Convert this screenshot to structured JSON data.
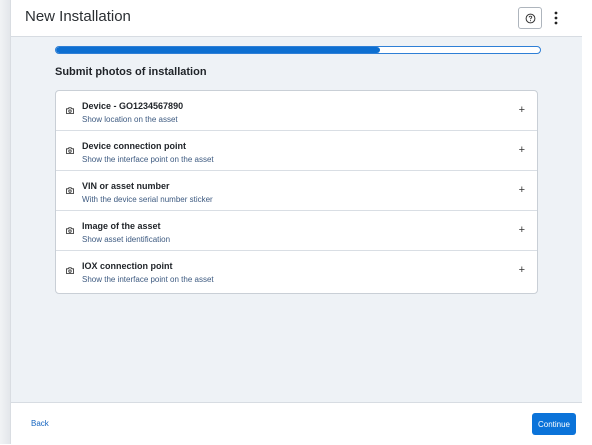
{
  "header": {
    "title": "New Installation",
    "help_icon": "question-circle-icon",
    "more_icon": "more-vertical-icon"
  },
  "progress": {
    "fraction": 0.67
  },
  "section": {
    "title": "Submit photos of installation"
  },
  "photo_items": [
    {
      "label": "Device - GO1234567890",
      "sublabel": "Show location on the asset",
      "icon": "camera-icon",
      "action_icon": "plus-icon",
      "action": "+"
    },
    {
      "label": "Device connection point",
      "sublabel": "Show the interface point on the asset",
      "icon": "camera-icon",
      "action_icon": "plus-icon",
      "action": "+"
    },
    {
      "label": "VIN or asset number",
      "sublabel": "With the device serial number sticker",
      "icon": "camera-icon",
      "action_icon": "plus-icon",
      "action": "+"
    },
    {
      "label": "Image of the asset",
      "sublabel": "Show asset identification",
      "icon": "camera-icon",
      "action_icon": "plus-icon",
      "action": "+"
    },
    {
      "label": "IOX connection point",
      "sublabel": "Show the interface point on the asset",
      "icon": "camera-icon",
      "action_icon": "plus-icon",
      "action": "+"
    }
  ],
  "footer": {
    "back_label": "Back",
    "continue_label": "Continue"
  },
  "colors": {
    "accent": "#0b73d9",
    "progress_fill": "#0d6fd1",
    "background": "#eef2f6",
    "sublabel": "#3d5a80"
  }
}
